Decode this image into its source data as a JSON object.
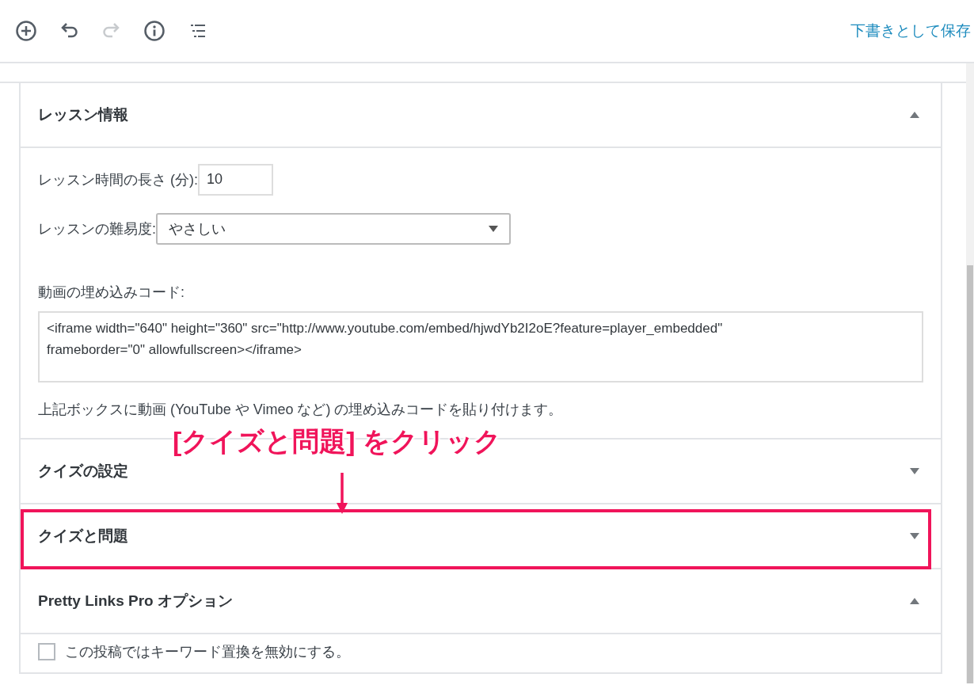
{
  "toolbar": {
    "save_draft": "下書きとして保存",
    "redo_disabled": true
  },
  "sections": [
    {
      "kind": "lesson",
      "title": "レッスン情報",
      "expanded": true,
      "highlighted": false,
      "fields": [
        {
          "kind": "text",
          "label": "レッスン時間の長さ (分):",
          "value": "10"
        },
        {
          "kind": "select",
          "label": "レッスンの難易度:",
          "value": "やさしい"
        },
        {
          "kind": "textarea",
          "label": "動画の埋め込みコード:",
          "value": "<iframe width=\"640\" height=\"360\" src=\"http://www.youtube.com/embed/hjwdYb2I2oE?feature=player_embedded\" frameborder=\"0\" allowfullscreen></iframe>",
          "help": "上記ボックスに動画 (YouTube や Vimeo など) の埋め込みコードを貼り付けます。"
        }
      ]
    },
    {
      "title": "クイズの設定",
      "expanded": false,
      "highlighted": false
    },
    {
      "title": "クイズと問題",
      "expanded": false,
      "highlighted": true
    },
    {
      "kind": "checkbox",
      "title": "Pretty Links Pro オプション",
      "expanded": true,
      "highlighted": false,
      "checkbox": {
        "label": "この投稿ではキーワード置換を無効にする。",
        "checked": false
      }
    }
  ],
  "callout": {
    "text": "[クイズと問題] をクリック"
  }
}
